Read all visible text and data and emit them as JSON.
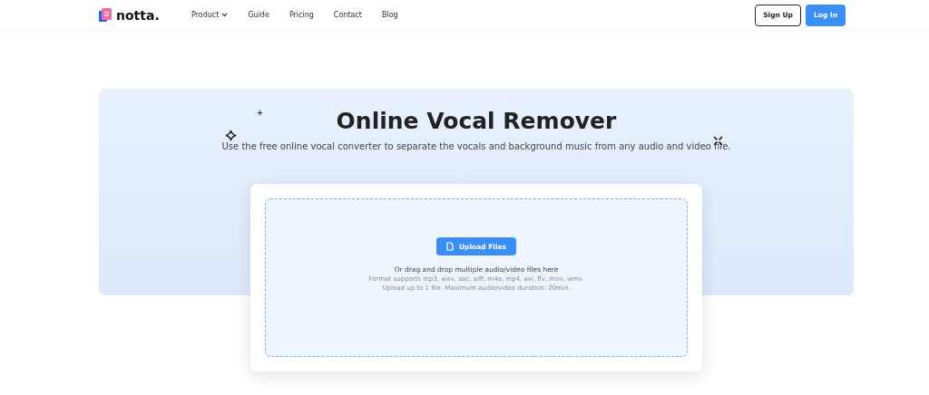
{
  "header": {
    "logo": "notta.",
    "nav": [
      {
        "label": "Product",
        "dropdown": true
      },
      {
        "label": "Guide",
        "dropdown": false
      },
      {
        "label": "Pricing",
        "dropdown": false
      },
      {
        "label": "Contact",
        "dropdown": false
      },
      {
        "label": "Blog",
        "dropdown": false
      }
    ],
    "buttons": [
      {
        "label": "Sign Up",
        "kind": "outline"
      },
      {
        "label": "Log In",
        "kind": "primary"
      }
    ]
  },
  "hero": {
    "title": "Online Vocal Remover",
    "subtitle": "Use the free online vocal converter to separate the vocals and background music from any audio and video file."
  },
  "upload": {
    "button": "Upload Files",
    "hint": "Or drag and drop multiple audio/video files here",
    "formats": "Format supports mp3, wav, aac, aiff, m4a, mp4, avi, flv, mov, wmv.",
    "limits": "Upload up to 1 file. Maximum audio/video duration: 20min."
  }
}
